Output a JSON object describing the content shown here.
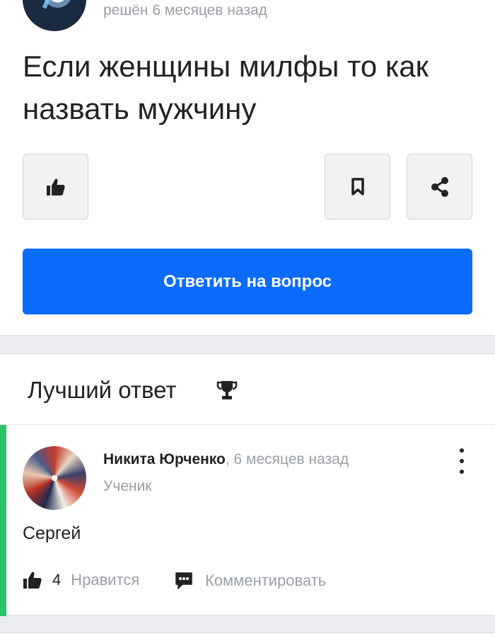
{
  "question": {
    "solved_meta": "решён 6 месяцев назад",
    "title": "Если женщины милфы то как назвать мужчину",
    "answer_button_label": "Ответить на вопрос"
  },
  "best_answer": {
    "heading": "Лучший ответ",
    "author_name": "Никита Юрченко",
    "time_separator": ", ",
    "time": "6 месяцев назад",
    "rank": "Ученик",
    "text": "Сергей",
    "like_count": "4",
    "like_label": "Нравится",
    "comment_label": "Комментировать"
  },
  "icons": {
    "like": "thumbs-up-icon",
    "bookmark": "bookmark-icon",
    "share": "share-icon",
    "trophy": "trophy-icon",
    "more": "more-vertical-icon",
    "comment": "comment-icon"
  },
  "colors": {
    "accent": "#0a6cff",
    "best_answer_bar": "#29c36a",
    "muted_text": "#9aa0a6"
  }
}
